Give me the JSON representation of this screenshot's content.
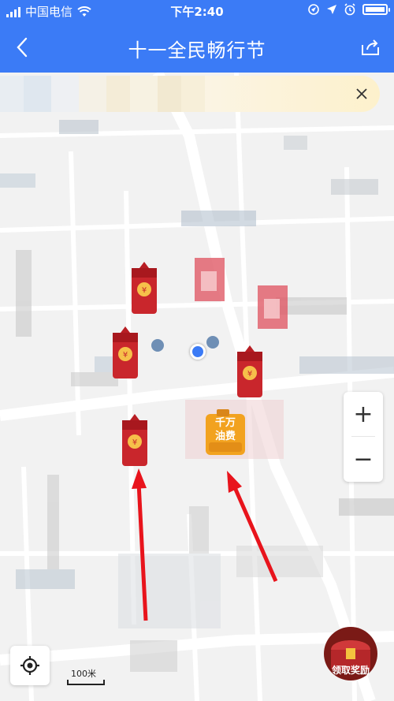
{
  "status_bar": {
    "carrier": "中国电信",
    "time": "下午2:40"
  },
  "nav": {
    "title": "十一全民畅行节"
  },
  "map": {
    "fuel_badge": {
      "label_line1": "千万",
      "label_line2": "油费"
    },
    "scale_label": "100米",
    "envelope_symbol": "¥",
    "chest_label": "领取奖励"
  },
  "controls": {
    "zoom_in": "+",
    "zoom_out": "−"
  },
  "icons": [
    "signal-icon",
    "wifi-icon",
    "location-icon",
    "alarm-icon",
    "battery-icon",
    "back-icon",
    "share-icon",
    "close-icon",
    "locate-icon",
    "red-envelope-icon",
    "fuel-can-icon",
    "treasure-chest-icon"
  ],
  "colors": {
    "header": "#3b7bf6",
    "envelope_red": "#c9262c",
    "arrow_red": "#e8141c",
    "fuel_orange": "#f2a21f"
  }
}
